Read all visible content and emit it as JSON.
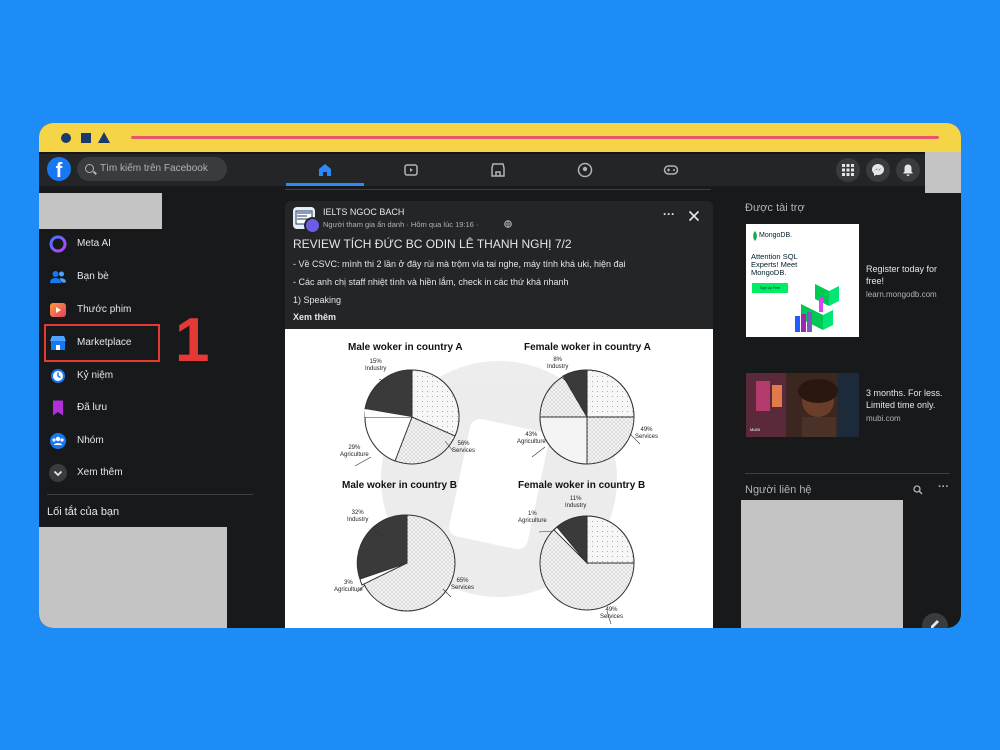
{
  "browser": {
    "window_controls": [
      "circle",
      "square",
      "triangle"
    ]
  },
  "header": {
    "search_placeholder": "Tìm kiếm trên Facebook",
    "nav_tabs": [
      {
        "name": "home-icon",
        "active": true
      },
      {
        "name": "video-icon",
        "active": false
      },
      {
        "name": "marketplace-icon",
        "active": false
      },
      {
        "name": "groups-icon",
        "active": false
      },
      {
        "name": "gaming-icon",
        "active": false
      }
    ],
    "right_buttons": [
      "menu-grid-icon",
      "messenger-icon",
      "notification-bell-icon"
    ]
  },
  "sidebar": {
    "items": [
      {
        "label": "Meta AI",
        "icon": "meta-ai-icon",
        "color": "#7b61ff"
      },
      {
        "label": "Bạn bè",
        "icon": "friends-icon",
        "color": "#1877f2"
      },
      {
        "label": "Thước phim",
        "icon": "reels-icon",
        "color": "#e4405f"
      },
      {
        "label": "Marketplace",
        "icon": "marketplace-store-icon",
        "color": "#1877f2"
      },
      {
        "label": "Kỷ niệm",
        "icon": "memories-icon",
        "color": "#1877f2"
      },
      {
        "label": "Đã lưu",
        "icon": "saved-icon",
        "color": "#a033ff"
      },
      {
        "label": "Nhóm",
        "icon": "groups-icon",
        "color": "#1877f2"
      },
      {
        "label": "Xem thêm",
        "icon": "chevron-down-icon",
        "color": "#3a3b3c"
      }
    ],
    "shortcuts_title": "Lối tắt của bạn"
  },
  "annotation": {
    "number": "1",
    "color": "#e53935"
  },
  "post": {
    "author": "IELTS NGOC BACH",
    "meta": "Người tham gia ẩn danh · Hôm qua lúc 19:16 ·",
    "title": "REVIEW TÍCH ĐỨC BC ODIN LÊ THANH NGHỊ 7/2",
    "lines": [
      "- Về CSVC: mình thi 2 lần ở đây rùi mà trộm vía tai nghe, máy tính khá uki, hiện đại",
      "- Các anh chị staff nhiệt tình và hiền lắm, check in các thứ khá nhanh",
      "1) Speaking"
    ],
    "see_more": "Xem thêm",
    "image": {
      "charts": [
        {
          "title": "Male woker in country A",
          "labels": {
            "industry": "15%\nIndustry",
            "agriculture": "29%\nAgriculture",
            "services": "56%\nServices"
          }
        },
        {
          "title": "Female woker in country A",
          "labels": {
            "industry": "8%\nIndustry",
            "agriculture": "43%\nAgriculture",
            "services": "49%\nServices"
          }
        },
        {
          "title": "Male woker in country B",
          "labels": {
            "industry": "32%\nIndustry",
            "agriculture": "3%\nAgriculture",
            "services": "65%\nServices"
          }
        },
        {
          "title": "Female woker in country B",
          "labels": {
            "industry": "11%\nIndustry",
            "agriculture": "1%\nAgriculture",
            "services": "49%\nServices"
          }
        }
      ]
    }
  },
  "right": {
    "sponsored_title": "Được tài trợ",
    "ads": [
      {
        "card_brand": "MongoDB.",
        "card_headline": "Attention SQL Experts! Meet MongoDB.",
        "card_button": "Sign Up Free",
        "text": "Register today for free!",
        "domain": "learn.mongodb.com"
      },
      {
        "card_caption": "MUBI",
        "text": "3 months. For less. Limited time only.",
        "domain": "mubi.com"
      }
    ],
    "contacts_title": "Người liên hệ"
  }
}
